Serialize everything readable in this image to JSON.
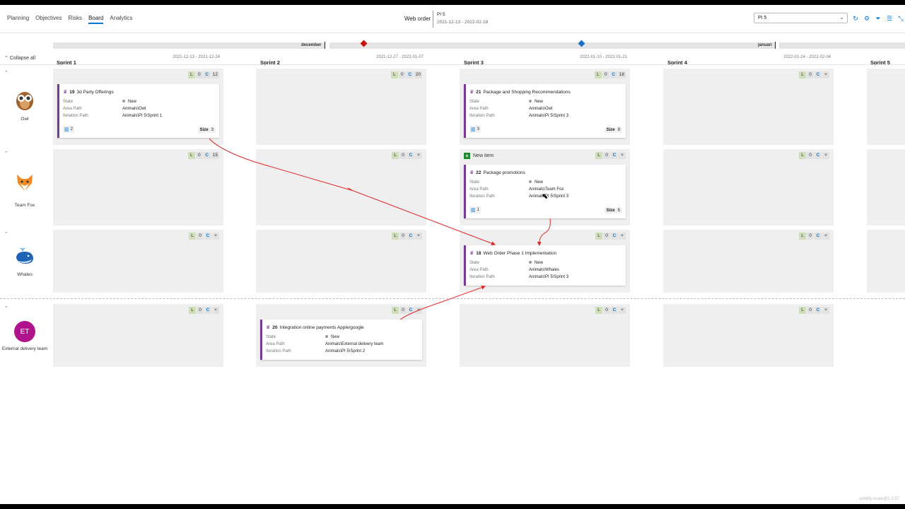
{
  "nav": {
    "tabs": [
      "Planning",
      "Objectives",
      "Risks",
      "Board",
      "Analytics"
    ],
    "active_tab": "Board"
  },
  "header": {
    "title": "Web order",
    "pi_name": "PI 5",
    "pi_dates": "2021-12-13 - 2022-02-18",
    "select_value": "PI 5"
  },
  "timeline": {
    "months": [
      "december",
      "januari"
    ]
  },
  "collapse_label": "Collapse all",
  "sprints": [
    {
      "name": "Sprint 1",
      "dates": "2021-12-13 - 2021-12-24"
    },
    {
      "name": "Sprint 2",
      "dates": "2021-12-27 - 2022-01-07"
    },
    {
      "name": "Sprint 3",
      "dates": "2022-01-10 - 2022-01-21"
    },
    {
      "name": "Sprint 4",
      "dates": "2022-01-24 - 2022-02-04"
    },
    {
      "name": "Sprint 5",
      "dates": ""
    }
  ],
  "teams": [
    {
      "name": "Owl",
      "icon": "owl-icon"
    },
    {
      "name": "Team Fox",
      "icon": "fox-icon"
    },
    {
      "name": "Whales",
      "icon": "whale-icon"
    },
    {
      "name": "External delivery team",
      "initials": "ET"
    }
  ],
  "cells": {
    "owl_s1": {
      "L": "L",
      "zero": "0",
      "C": "C",
      "count": "12"
    },
    "owl_s2": {
      "L": "L",
      "zero": "0",
      "C": "C",
      "count": "20"
    },
    "owl_s3": {
      "L": "L",
      "zero": "0",
      "C": "C",
      "count": "18"
    },
    "owl_s4": {
      "L": "L",
      "zero": "0",
      "C": "C",
      "count": "+"
    },
    "fox_s1": {
      "L": "L",
      "zero": "0",
      "C": "C",
      "count": "15"
    },
    "fox_s2": {
      "L": "L",
      "zero": "0",
      "C": "C",
      "count": "+"
    },
    "fox_s3": {
      "L": "L",
      "zero": "0",
      "C": "C",
      "count": "+"
    },
    "fox_s4": {
      "L": "L",
      "zero": "0",
      "C": "C",
      "count": "+"
    },
    "wh_s1": {
      "L": "L",
      "zero": "0",
      "C": "C",
      "count": "+"
    },
    "wh_s2": {
      "L": "L",
      "zero": "0",
      "C": "C",
      "count": "+"
    },
    "wh_s3": {
      "L": "L",
      "zero": "0",
      "C": "C",
      "count": "+"
    },
    "wh_s4": {
      "L": "L",
      "zero": "0",
      "C": "C",
      "count": "+"
    },
    "et_s1": {
      "L": "L",
      "zero": "0",
      "C": "C",
      "count": "+"
    },
    "et_s2": {
      "L": "L",
      "zero": "0",
      "C": "C",
      "count": "+"
    },
    "et_s3": {
      "L": "L",
      "zero": "0",
      "C": "C",
      "count": "+"
    },
    "et_s4": {
      "L": "L",
      "zero": "0",
      "C": "C",
      "count": "+"
    }
  },
  "new_item_label": "New item",
  "field_labels": {
    "state": "State",
    "area": "Area Path",
    "iteration": "Iteration Path",
    "size": "Size"
  },
  "cards": {
    "c19": {
      "id": "19",
      "title": "3d Party Offerings",
      "state": "New",
      "area": "Animals\\Owl",
      "iteration": "Animals\\PI 5\\Sprint 1",
      "stories": "2",
      "size": "3"
    },
    "c21": {
      "id": "21",
      "title": "Package and Shopping Recommendations",
      "state": "New",
      "area": "Animals\\Owl",
      "iteration": "Animals\\PI 5\\Sprint 3",
      "stories": "3",
      "size": "9"
    },
    "c22": {
      "id": "22",
      "title": "Package promotions",
      "state": "New",
      "area": "Animals\\Team Fox",
      "iteration": "Animals\\PI 5\\Sprint 3",
      "stories": "1",
      "size": "5"
    },
    "c18": {
      "id": "18",
      "title": "Web Order Phase 1 Implementation",
      "state": "New",
      "area": "Animals\\Whales",
      "iteration": "Animals\\PI 5\\Sprint 3"
    },
    "c20": {
      "id": "20",
      "title": "Integration online payments Apple/google",
      "state": "New",
      "area": "Animals\\External delivery team",
      "iteration": "Animals\\PI 5\\Sprint 2"
    }
  },
  "colors": {
    "accent": "#0078d4",
    "feature": "#773b93",
    "dependency": "#e02a2a",
    "milestone_red": "#cc1111",
    "milestone_blue": "#1a73c8"
  },
  "watermark": "solidify-scale@1.3.57"
}
